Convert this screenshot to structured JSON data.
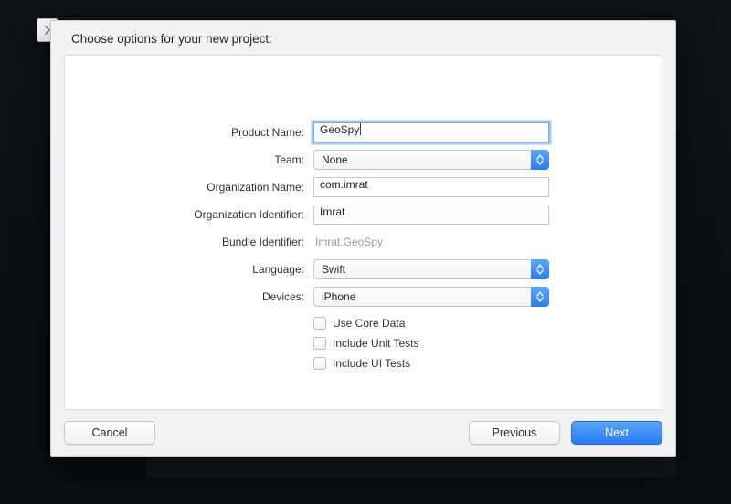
{
  "header": {
    "title": "Choose options for your new project:"
  },
  "labels": {
    "product_name": "Product Name:",
    "team": "Team:",
    "org_name": "Organization Name:",
    "org_id": "Organization Identifier:",
    "bundle_id": "Bundle Identifier:",
    "language": "Language:",
    "devices": "Devices:"
  },
  "values": {
    "product_name": "GeoSpy",
    "team": "None",
    "org_name": "com.imrat",
    "org_id": "Imrat",
    "bundle_id": "Imrat.GeoSpy",
    "language": "Swift",
    "devices": "iPhone"
  },
  "checkboxes": {
    "core_data": "Use Core Data",
    "unit_tests": "Include Unit Tests",
    "ui_tests": "Include UI Tests"
  },
  "buttons": {
    "cancel": "Cancel",
    "previous": "Previous",
    "next": "Next"
  }
}
